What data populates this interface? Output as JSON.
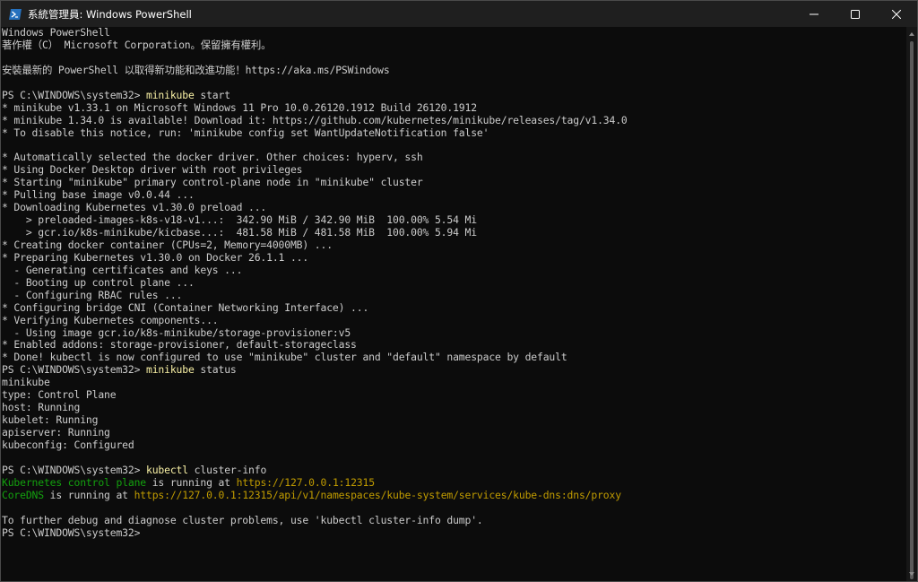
{
  "window": {
    "title": "系統管理員: Windows PowerShell",
    "app_icon": "powershell-icon",
    "controls": [
      "minimize-icon",
      "maximize-icon",
      "close-icon"
    ]
  },
  "terminal": {
    "lines": [
      [
        {
          "t": "Windows PowerShell"
        }
      ],
      [
        {
          "t": "著作權（C） Microsoft Corporation。保留擁有權利。"
        }
      ],
      [
        {
          "t": ""
        }
      ],
      [
        {
          "t": "安裝最新的 PowerShell 以取得新功能和改進功能！https://aka.ms/PSWindows"
        }
      ],
      [
        {
          "t": ""
        }
      ],
      [
        {
          "t": "PS C:\\WINDOWS\\system32> "
        },
        {
          "t": "minikube",
          "c": "cmd"
        },
        {
          "t": " start"
        }
      ],
      [
        {
          "t": "* minikube v1.33.1 on Microsoft Windows 11 Pro 10.0.26120.1912 Build 26120.1912"
        }
      ],
      [
        {
          "t": "* minikube 1.34.0 is available! Download it: https://github.com/kubernetes/minikube/releases/tag/v1.34.0"
        }
      ],
      [
        {
          "t": "* To disable this notice, run: 'minikube config set WantUpdateNotification false'"
        }
      ],
      [
        {
          "t": ""
        }
      ],
      [
        {
          "t": "* Automatically selected the docker driver. Other choices: hyperv, ssh"
        }
      ],
      [
        {
          "t": "* Using Docker Desktop driver with root privileges"
        }
      ],
      [
        {
          "t": "* Starting \"minikube\" primary control-plane node in \"minikube\" cluster"
        }
      ],
      [
        {
          "t": "* Pulling base image v0.0.44 ..."
        }
      ],
      [
        {
          "t": "* Downloading Kubernetes v1.30.0 preload ..."
        }
      ],
      [
        {
          "t": "    > preloaded-images-k8s-v18-v1...:  342.90 MiB / 342.90 MiB  100.00% 5.54 Mi"
        }
      ],
      [
        {
          "t": "    > gcr.io/k8s-minikube/kicbase...:  481.58 MiB / 481.58 MiB  100.00% 5.94 Mi"
        }
      ],
      [
        {
          "t": "* Creating docker container (CPUs=2, Memory=4000MB) ..."
        }
      ],
      [
        {
          "t": "* Preparing Kubernetes v1.30.0 on Docker 26.1.1 ..."
        }
      ],
      [
        {
          "t": "  - Generating certificates and keys ..."
        }
      ],
      [
        {
          "t": "  - Booting up control plane ..."
        }
      ],
      [
        {
          "t": "  - Configuring RBAC rules ..."
        }
      ],
      [
        {
          "t": "* Configuring bridge CNI (Container Networking Interface) ..."
        }
      ],
      [
        {
          "t": "* Verifying Kubernetes components..."
        }
      ],
      [
        {
          "t": "  - Using image gcr.io/k8s-minikube/storage-provisioner:v5"
        }
      ],
      [
        {
          "t": "* Enabled addons: storage-provisioner, default-storageclass"
        }
      ],
      [
        {
          "t": "* Done! kubectl is now configured to use \"minikube\" cluster and \"default\" namespace by default"
        }
      ],
      [
        {
          "t": "PS C:\\WINDOWS\\system32> "
        },
        {
          "t": "minikube",
          "c": "cmd"
        },
        {
          "t": " status"
        }
      ],
      [
        {
          "t": "minikube"
        }
      ],
      [
        {
          "t": "type: Control Plane"
        }
      ],
      [
        {
          "t": "host: Running"
        }
      ],
      [
        {
          "t": "kubelet: Running"
        }
      ],
      [
        {
          "t": "apiserver: Running"
        }
      ],
      [
        {
          "t": "kubeconfig: Configured"
        }
      ],
      [
        {
          "t": ""
        }
      ],
      [
        {
          "t": "PS C:\\WINDOWS\\system32> "
        },
        {
          "t": "kubectl",
          "c": "cmd"
        },
        {
          "t": " cluster-info"
        }
      ],
      [
        {
          "t": "Kubernetes control plane",
          "c": "green"
        },
        {
          "t": " is running at "
        },
        {
          "t": "https://127.0.0.1:12315",
          "c": "yellow"
        }
      ],
      [
        {
          "t": "CoreDNS",
          "c": "green"
        },
        {
          "t": " is running at "
        },
        {
          "t": "https://127.0.0.1:12315/api/v1/namespaces/kube-system/services/kube-dns:dns/proxy",
          "c": "yellow"
        }
      ],
      [
        {
          "t": ""
        }
      ],
      [
        {
          "t": "To further debug and diagnose cluster problems, use 'kubectl cluster-info dump'."
        }
      ],
      [
        {
          "t": "PS C:\\WINDOWS\\system32>"
        }
      ]
    ]
  },
  "colors": {
    "background": "#0c0c0c",
    "text": "#cccccc",
    "command": "#f9f1a5",
    "green": "#13a10e",
    "yellow": "#c19c00"
  }
}
